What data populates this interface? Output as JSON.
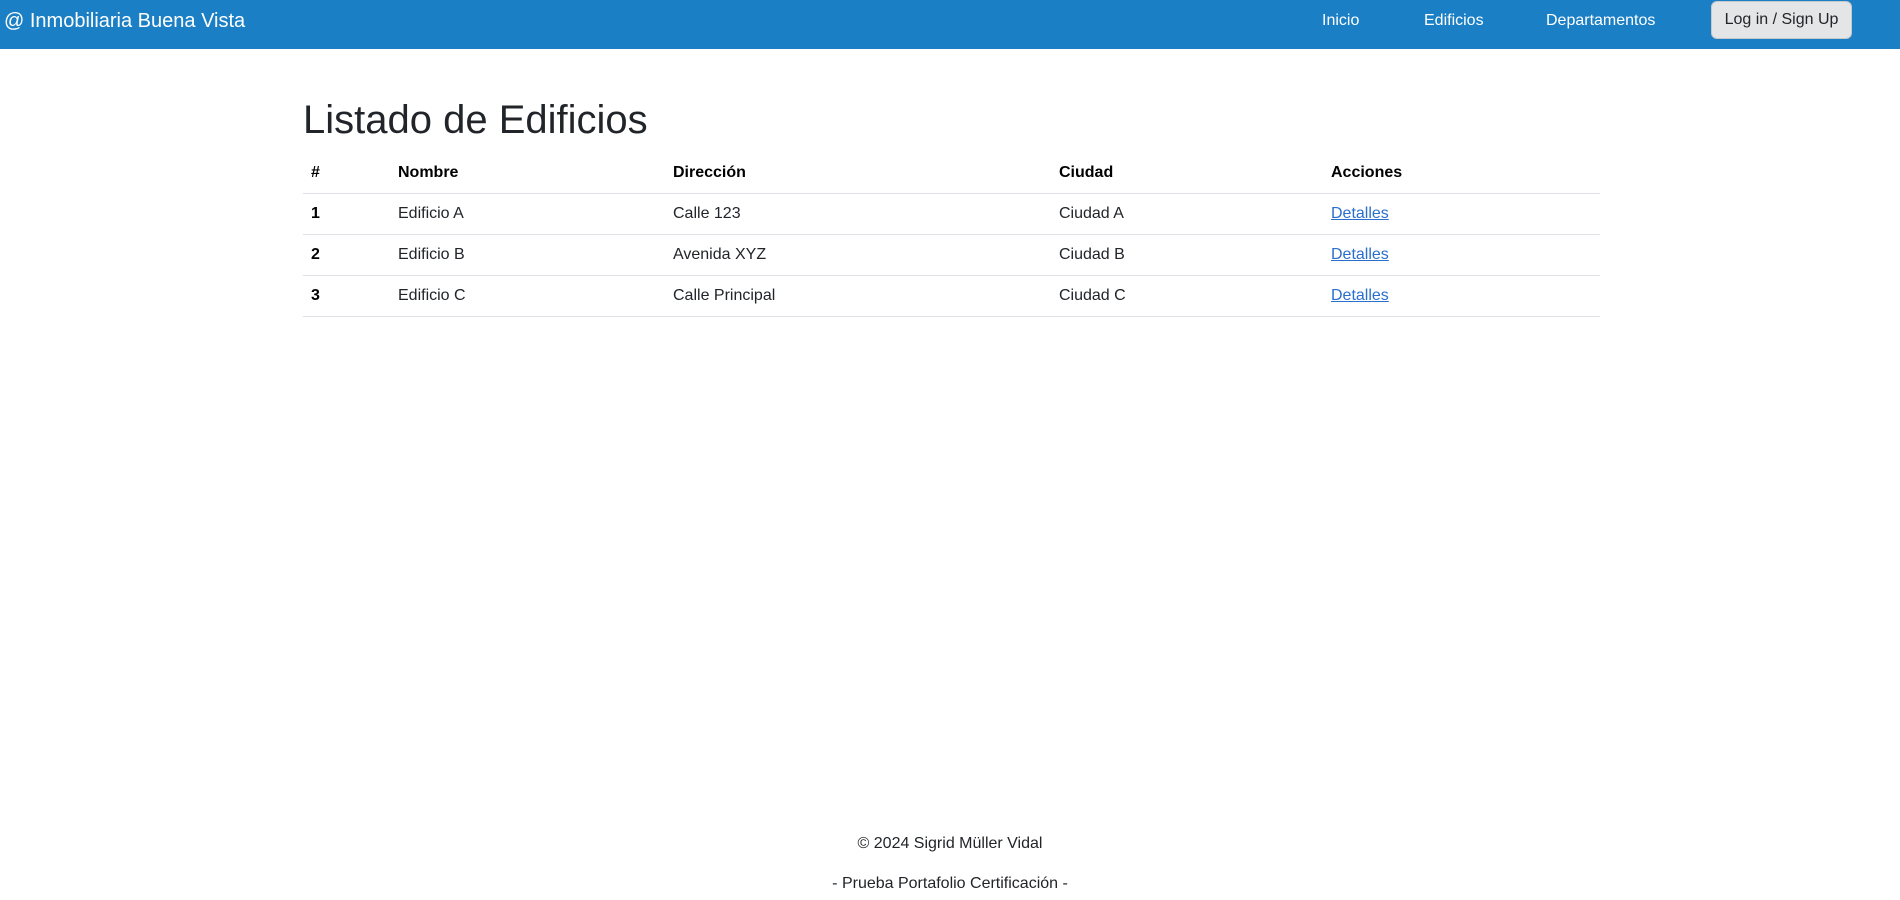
{
  "navbar": {
    "brand": "@ Inmobiliaria Buena Vista",
    "links": [
      "Inicio",
      "Edificios",
      "Departamentos"
    ],
    "login_label": "Log in / Sign Up",
    "bg_color": "#1a7fc4"
  },
  "main": {
    "title": "Listado de Edificios",
    "table": {
      "headers": [
        "#",
        "Nombre",
        "Dirección",
        "Ciudad",
        "Acciones"
      ],
      "rows": [
        {
          "num": "1",
          "nombre": "Edificio A",
          "direccion": "Calle 123",
          "ciudad": "Ciudad A",
          "accion": "Detalles"
        },
        {
          "num": "2",
          "nombre": "Edificio B",
          "direccion": "Avenida XYZ",
          "ciudad": "Ciudad B",
          "accion": "Detalles"
        },
        {
          "num": "3",
          "nombre": "Edificio C",
          "direccion": "Calle Principal",
          "ciudad": "Ciudad C",
          "accion": "Detalles"
        }
      ]
    }
  },
  "footer": {
    "copyright": "© 2024 Sigrid Müller Vidal",
    "subtitle": "- Prueba Portafolio Certificación -"
  }
}
